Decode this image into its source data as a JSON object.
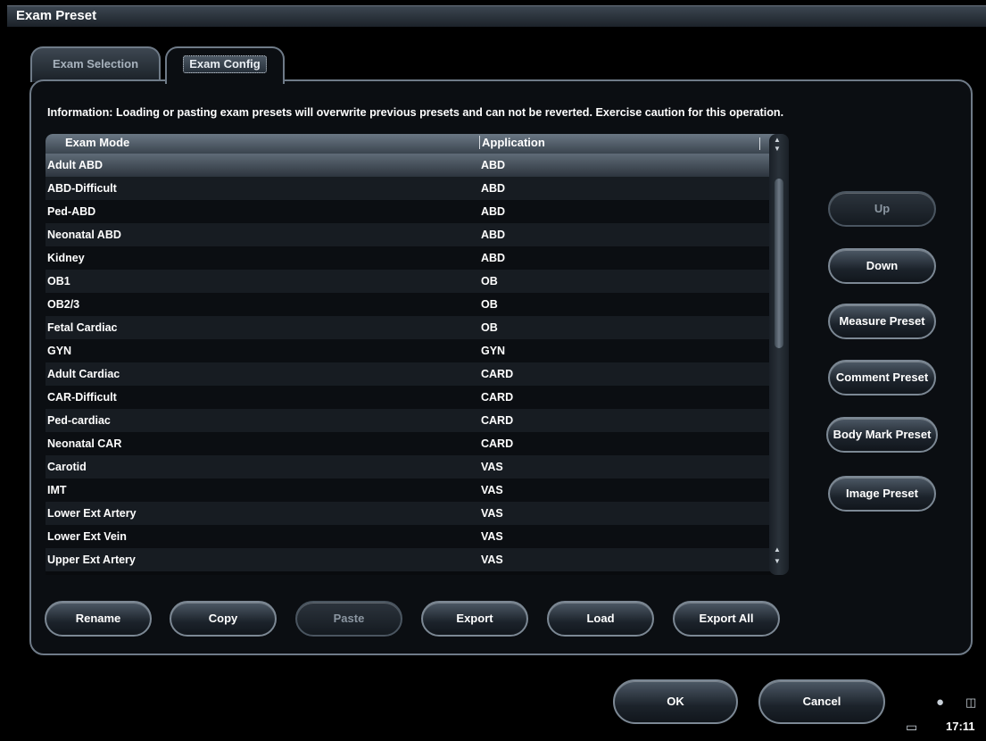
{
  "window": {
    "title": "Exam Preset"
  },
  "tabs": [
    {
      "label": "Exam Selection",
      "active": false
    },
    {
      "label": "Exam Config",
      "active": true
    }
  ],
  "info_text": "Information: Loading or pasting exam presets will overwrite previous presets and can not be reverted. Exercise caution for this operation.",
  "table": {
    "headers": [
      "Exam Mode",
      "Application"
    ],
    "selected_index": 0,
    "rows": [
      {
        "mode": "Adult ABD",
        "app": "ABD"
      },
      {
        "mode": "ABD-Difficult",
        "app": "ABD"
      },
      {
        "mode": "Ped-ABD",
        "app": "ABD"
      },
      {
        "mode": "Neonatal ABD",
        "app": "ABD"
      },
      {
        "mode": "Kidney",
        "app": "ABD"
      },
      {
        "mode": "OB1",
        "app": "OB"
      },
      {
        "mode": "OB2/3",
        "app": "OB"
      },
      {
        "mode": "Fetal Cardiac",
        "app": "OB"
      },
      {
        "mode": "GYN",
        "app": "GYN"
      },
      {
        "mode": "Adult Cardiac",
        "app": "CARD"
      },
      {
        "mode": "CAR-Difficult",
        "app": "CARD"
      },
      {
        "mode": "Ped-cardiac",
        "app": "CARD"
      },
      {
        "mode": "Neonatal CAR",
        "app": "CARD"
      },
      {
        "mode": "Carotid",
        "app": "VAS"
      },
      {
        "mode": "IMT",
        "app": "VAS"
      },
      {
        "mode": "Lower Ext Artery",
        "app": "VAS"
      },
      {
        "mode": "Lower Ext Vein",
        "app": "VAS"
      },
      {
        "mode": "Upper Ext Artery",
        "app": "VAS"
      }
    ]
  },
  "side_buttons": {
    "up": "Up",
    "down": "Down",
    "measure": "Measure Preset",
    "comment": "Comment Preset",
    "bodymark": "Body Mark Preset",
    "image": "Image Preset"
  },
  "bottom_buttons": {
    "rename": "Rename",
    "copy": "Copy",
    "paste": "Paste",
    "export": "Export",
    "load": "Load",
    "export_all": "Export All"
  },
  "dialog_buttons": {
    "ok": "OK",
    "cancel": "Cancel"
  },
  "status": {
    "time": "17:11"
  }
}
